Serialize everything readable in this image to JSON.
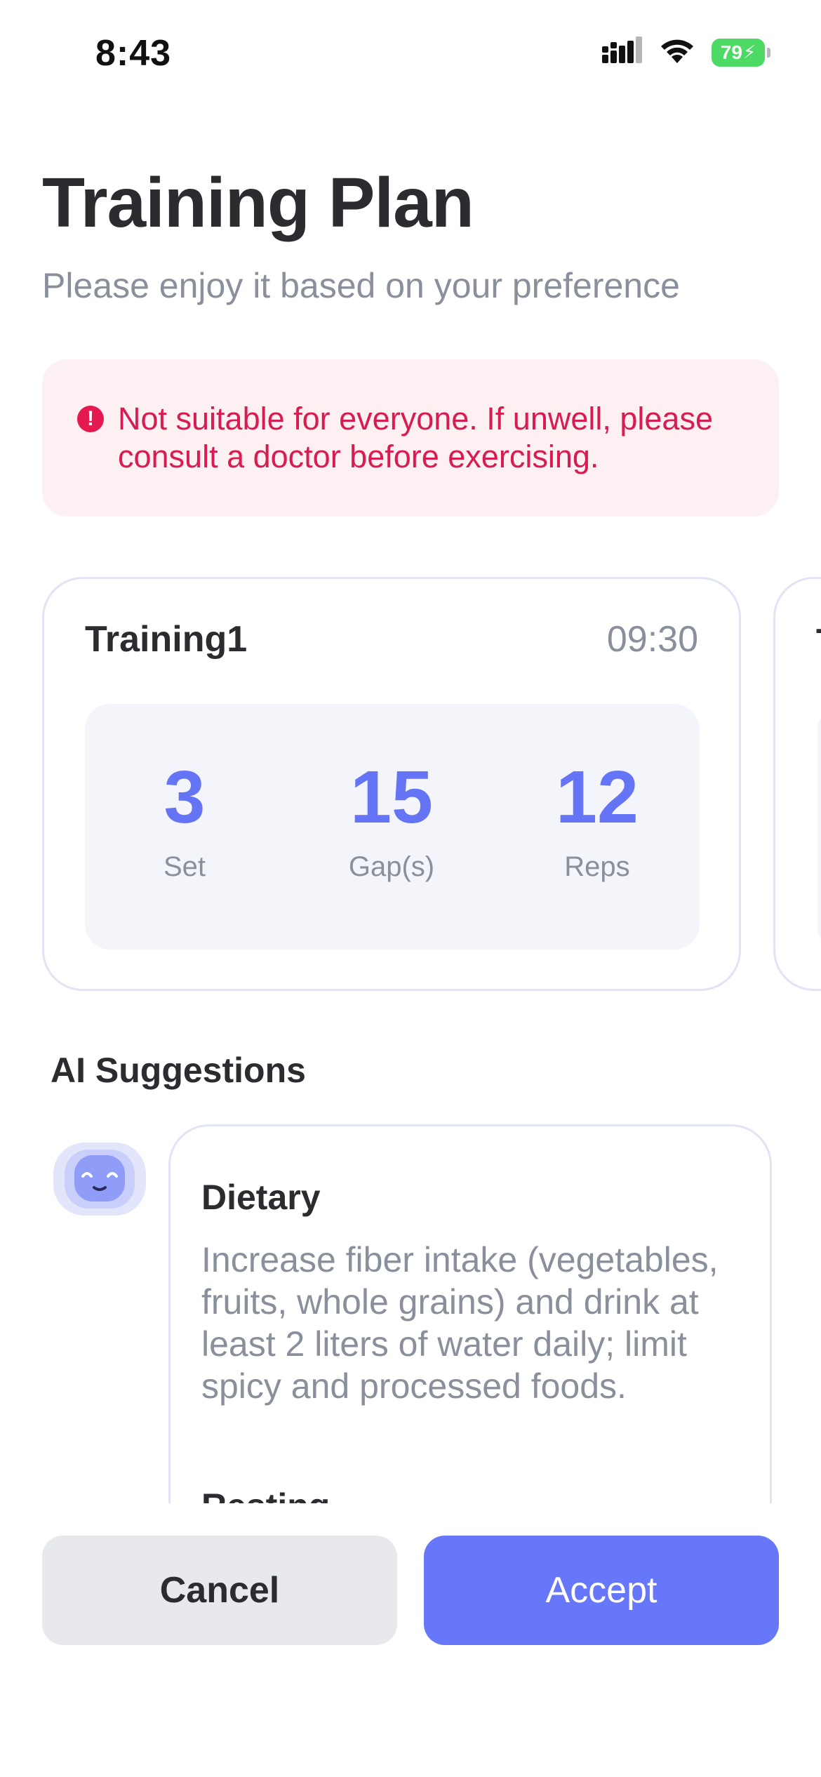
{
  "status_bar": {
    "time": "8:43",
    "battery": "79",
    "icons": [
      "cellular-signal-icon",
      "wifi-icon",
      "battery-charging-icon"
    ]
  },
  "header": {
    "title": "Training Plan",
    "subtitle": "Please enjoy it based on your preference"
  },
  "warning": {
    "icon": "exclamation-circle-icon",
    "text": "Not suitable for everyone. If unwell, please consult a doctor before exercising.",
    "color": "#d81b50"
  },
  "training_cards": [
    {
      "title": "Training1",
      "time": "09:30",
      "stats": [
        {
          "value": "3",
          "label": "Set"
        },
        {
          "value": "15",
          "label": "Gap(s)"
        },
        {
          "value": "12",
          "label": "Reps"
        }
      ]
    },
    {
      "title_peek": "T"
    }
  ],
  "ai_suggestions": {
    "title": "AI Suggestions",
    "avatar_icon": "robot-assistant-icon",
    "items": [
      {
        "heading": "Dietary",
        "body": "Increase fiber intake (vegetables, fruits, whole grains) and drink at least 2 liters of water daily; limit spicy and processed foods."
      },
      {
        "heading": "Resting"
      }
    ]
  },
  "actions": {
    "cancel_label": "Cancel",
    "accept_label": "Accept"
  },
  "colors": {
    "accent": "#6777fa",
    "stat_value": "#6474f5",
    "warning_bg": "#fdf0f3"
  }
}
